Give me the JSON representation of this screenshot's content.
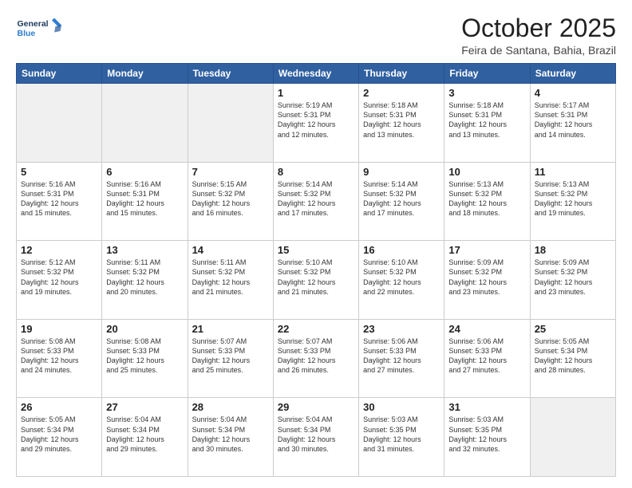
{
  "header": {
    "logo_line1": "General",
    "logo_line2": "Blue",
    "month_title": "October 2025",
    "subtitle": "Feira de Santana, Bahia, Brazil"
  },
  "days_of_week": [
    "Sunday",
    "Monday",
    "Tuesday",
    "Wednesday",
    "Thursday",
    "Friday",
    "Saturday"
  ],
  "weeks": [
    [
      {
        "day": "",
        "info": ""
      },
      {
        "day": "",
        "info": ""
      },
      {
        "day": "",
        "info": ""
      },
      {
        "day": "1",
        "info": "Sunrise: 5:19 AM\nSunset: 5:31 PM\nDaylight: 12 hours\nand 12 minutes."
      },
      {
        "day": "2",
        "info": "Sunrise: 5:18 AM\nSunset: 5:31 PM\nDaylight: 12 hours\nand 13 minutes."
      },
      {
        "day": "3",
        "info": "Sunrise: 5:18 AM\nSunset: 5:31 PM\nDaylight: 12 hours\nand 13 minutes."
      },
      {
        "day": "4",
        "info": "Sunrise: 5:17 AM\nSunset: 5:31 PM\nDaylight: 12 hours\nand 14 minutes."
      }
    ],
    [
      {
        "day": "5",
        "info": "Sunrise: 5:16 AM\nSunset: 5:31 PM\nDaylight: 12 hours\nand 15 minutes."
      },
      {
        "day": "6",
        "info": "Sunrise: 5:16 AM\nSunset: 5:31 PM\nDaylight: 12 hours\nand 15 minutes."
      },
      {
        "day": "7",
        "info": "Sunrise: 5:15 AM\nSunset: 5:32 PM\nDaylight: 12 hours\nand 16 minutes."
      },
      {
        "day": "8",
        "info": "Sunrise: 5:14 AM\nSunset: 5:32 PM\nDaylight: 12 hours\nand 17 minutes."
      },
      {
        "day": "9",
        "info": "Sunrise: 5:14 AM\nSunset: 5:32 PM\nDaylight: 12 hours\nand 17 minutes."
      },
      {
        "day": "10",
        "info": "Sunrise: 5:13 AM\nSunset: 5:32 PM\nDaylight: 12 hours\nand 18 minutes."
      },
      {
        "day": "11",
        "info": "Sunrise: 5:13 AM\nSunset: 5:32 PM\nDaylight: 12 hours\nand 19 minutes."
      }
    ],
    [
      {
        "day": "12",
        "info": "Sunrise: 5:12 AM\nSunset: 5:32 PM\nDaylight: 12 hours\nand 19 minutes."
      },
      {
        "day": "13",
        "info": "Sunrise: 5:11 AM\nSunset: 5:32 PM\nDaylight: 12 hours\nand 20 minutes."
      },
      {
        "day": "14",
        "info": "Sunrise: 5:11 AM\nSunset: 5:32 PM\nDaylight: 12 hours\nand 21 minutes."
      },
      {
        "day": "15",
        "info": "Sunrise: 5:10 AM\nSunset: 5:32 PM\nDaylight: 12 hours\nand 21 minutes."
      },
      {
        "day": "16",
        "info": "Sunrise: 5:10 AM\nSunset: 5:32 PM\nDaylight: 12 hours\nand 22 minutes."
      },
      {
        "day": "17",
        "info": "Sunrise: 5:09 AM\nSunset: 5:32 PM\nDaylight: 12 hours\nand 23 minutes."
      },
      {
        "day": "18",
        "info": "Sunrise: 5:09 AM\nSunset: 5:32 PM\nDaylight: 12 hours\nand 23 minutes."
      }
    ],
    [
      {
        "day": "19",
        "info": "Sunrise: 5:08 AM\nSunset: 5:33 PM\nDaylight: 12 hours\nand 24 minutes."
      },
      {
        "day": "20",
        "info": "Sunrise: 5:08 AM\nSunset: 5:33 PM\nDaylight: 12 hours\nand 25 minutes."
      },
      {
        "day": "21",
        "info": "Sunrise: 5:07 AM\nSunset: 5:33 PM\nDaylight: 12 hours\nand 25 minutes."
      },
      {
        "day": "22",
        "info": "Sunrise: 5:07 AM\nSunset: 5:33 PM\nDaylight: 12 hours\nand 26 minutes."
      },
      {
        "day": "23",
        "info": "Sunrise: 5:06 AM\nSunset: 5:33 PM\nDaylight: 12 hours\nand 27 minutes."
      },
      {
        "day": "24",
        "info": "Sunrise: 5:06 AM\nSunset: 5:33 PM\nDaylight: 12 hours\nand 27 minutes."
      },
      {
        "day": "25",
        "info": "Sunrise: 5:05 AM\nSunset: 5:34 PM\nDaylight: 12 hours\nand 28 minutes."
      }
    ],
    [
      {
        "day": "26",
        "info": "Sunrise: 5:05 AM\nSunset: 5:34 PM\nDaylight: 12 hours\nand 29 minutes."
      },
      {
        "day": "27",
        "info": "Sunrise: 5:04 AM\nSunset: 5:34 PM\nDaylight: 12 hours\nand 29 minutes."
      },
      {
        "day": "28",
        "info": "Sunrise: 5:04 AM\nSunset: 5:34 PM\nDaylight: 12 hours\nand 30 minutes."
      },
      {
        "day": "29",
        "info": "Sunrise: 5:04 AM\nSunset: 5:34 PM\nDaylight: 12 hours\nand 30 minutes."
      },
      {
        "day": "30",
        "info": "Sunrise: 5:03 AM\nSunset: 5:35 PM\nDaylight: 12 hours\nand 31 minutes."
      },
      {
        "day": "31",
        "info": "Sunrise: 5:03 AM\nSunset: 5:35 PM\nDaylight: 12 hours\nand 32 minutes."
      },
      {
        "day": "",
        "info": ""
      }
    ]
  ]
}
